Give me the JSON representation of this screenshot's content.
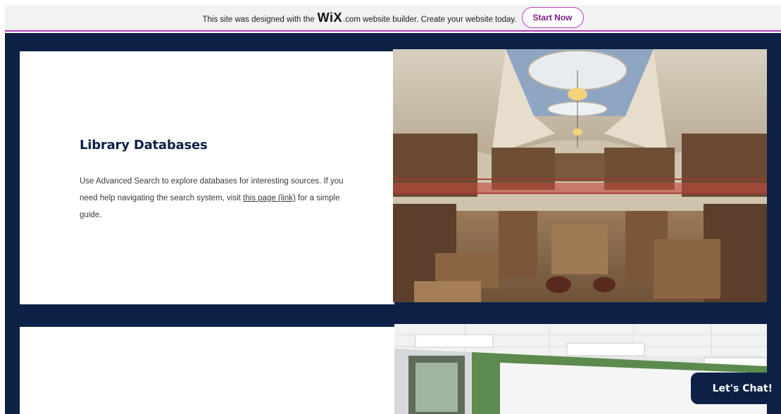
{
  "wix_banner": {
    "text_before": "This site was designed with the",
    "logo": "WiX",
    "text_after": ".com website builder. Create your website today.",
    "button_label": "Start Now"
  },
  "section1": {
    "title": "Library Databases",
    "body_part1": "Use Advanced Search to explore databases for interesting sources. If you need help navigating the search system, visit ",
    "link_text": "this page (link)",
    "body_part2": " for a simple guide."
  },
  "chat": {
    "label": "Let's Chat!"
  },
  "colors": {
    "navy": "#0c2145",
    "wix_accent": "#b23fb8",
    "banner_bg": "#f2f2f2"
  }
}
